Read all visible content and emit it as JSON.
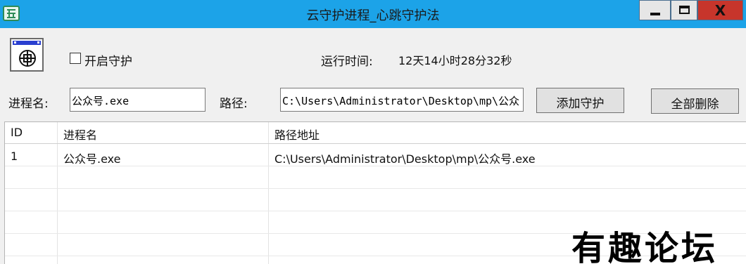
{
  "window": {
    "title": "云守护进程_心跳守护法",
    "close_glyph": "X"
  },
  "top": {
    "guard_checkbox_label": "开启守护",
    "guard_checked": false,
    "runtime_label": "运行时间:",
    "runtime_value": "12天14小时28分32秒"
  },
  "form": {
    "process_label": "进程名:",
    "process_value": "公众号.exe",
    "path_label": "路径:",
    "path_value": "C:\\Users\\Administrator\\Desktop\\mp\\公众",
    "add_button": "添加守护",
    "delete_all_button": "全部删除"
  },
  "table": {
    "columns": [
      "ID",
      "进程名",
      "路径地址"
    ],
    "rows": [
      [
        "1",
        "公众号.exe",
        "C:\\Users\\Administrator\\Desktop\\mp\\公众号.exe"
      ]
    ]
  },
  "watermark": "有趣论坛",
  "colors": {
    "titlebar": "#1ca3e8",
    "close_button": "#c7352b",
    "window_bg": "#f0f0f0"
  },
  "icons": [
    "app-icon",
    "minimize-icon",
    "maximize-icon",
    "close-icon",
    "program-icon"
  ]
}
